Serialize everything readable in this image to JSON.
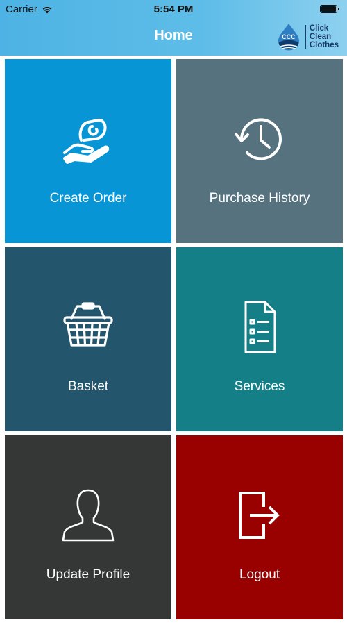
{
  "status_bar": {
    "carrier": "Carrier",
    "time": "5:54 PM"
  },
  "nav": {
    "title": "Home"
  },
  "logo": {
    "line1": "Click",
    "line2": "Clean",
    "line3": "Clothes",
    "mark_text": "CCC"
  },
  "tiles": [
    {
      "label": "Create Order",
      "icon": "hand-with-clothes-icon",
      "color": "#0795d6"
    },
    {
      "label": "Purchase History",
      "icon": "history-clock-icon",
      "color": "#56727f"
    },
    {
      "label": "Basket",
      "icon": "basket-icon",
      "color": "#23556d"
    },
    {
      "label": "Services",
      "icon": "document-list-icon",
      "color": "#147f87"
    },
    {
      "label": "Update Profile",
      "icon": "user-profile-icon",
      "color": "#353737"
    },
    {
      "label": "Logout",
      "icon": "logout-arrow-icon",
      "color": "#990000"
    }
  ],
  "colors": {
    "header_gradient_start": "#4db3e4",
    "header_gradient_end": "#8dd0ef",
    "logo_text": "#173a6a"
  }
}
